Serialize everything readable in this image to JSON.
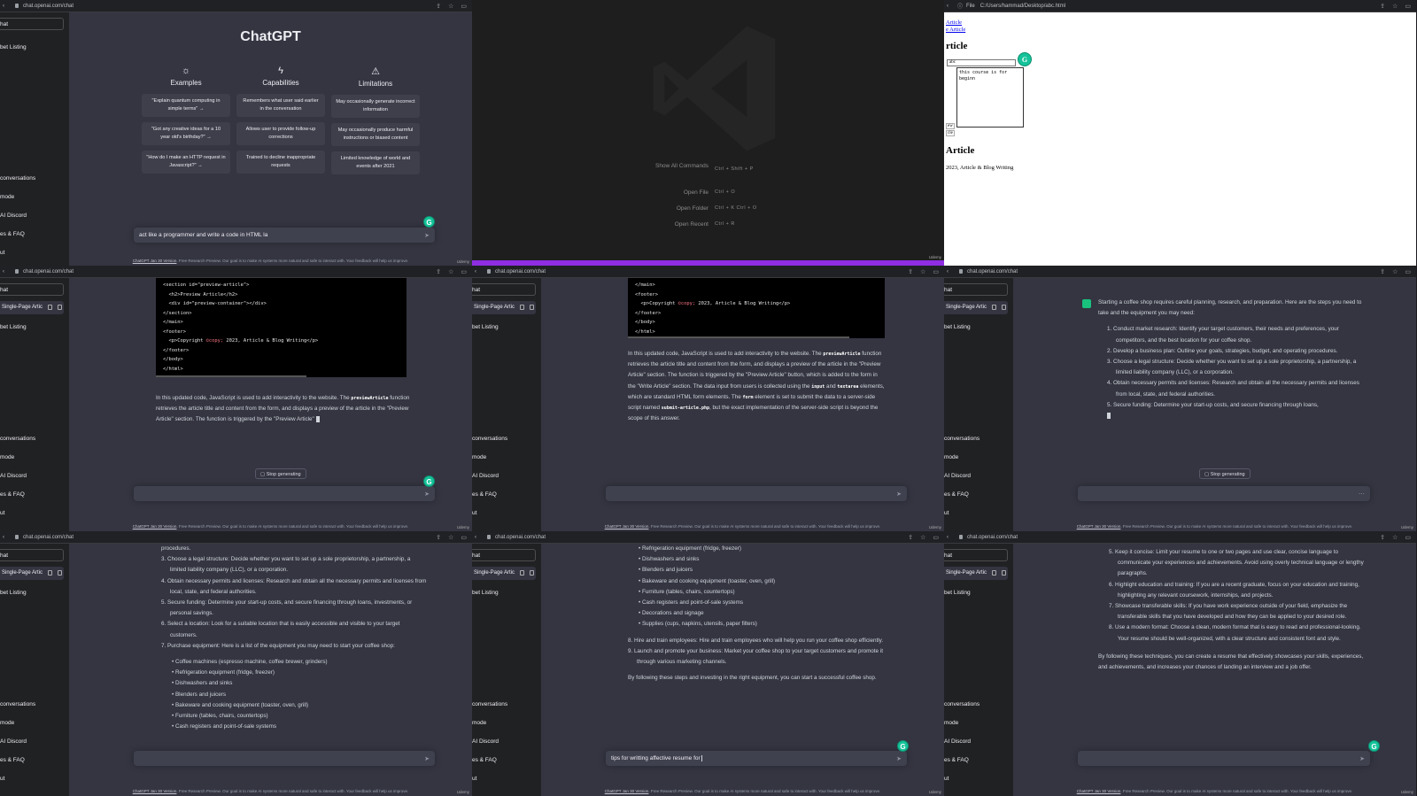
{
  "colors": {
    "accent": "#19c37d",
    "grammarly": "#15c39a",
    "bg": "#343541",
    "sidebar": "#202123",
    "purple": "#8e2de2"
  },
  "browser": {
    "url_chat": "chat.openai.com/chat",
    "file_label": "File",
    "url_file": "C:/Users/hammad/Desktop/abc.html"
  },
  "sidebar": {
    "chat_label": "hat",
    "listing_label": "bet Listing",
    "conv_title": "Single-Page Artic",
    "clear_label": "conversations",
    "mode_label": "mode",
    "discord_label": "AI Discord",
    "faq_label": "es & FAQ",
    "logout_label": "ut"
  },
  "footer": {
    "link": "ChatGPT Jan 30 Version",
    "text": ". Free Research Preview. Our goal is to make AI systems more natural and safe to interact with. Your feedback will help us improve.",
    "udemy": "Udemy"
  },
  "welcome": {
    "title": "ChatGPT",
    "columns": [
      {
        "heading": "Examples",
        "icon": "sun-icon",
        "cards": [
          "\"Explain quantum computing in simple terms\" →",
          "\"Got any creative ideas for a 10 year old's birthday?\" →",
          "\"How do I make an HTTP request in Javascript?\" →"
        ]
      },
      {
        "heading": "Capabilities",
        "icon": "lightning-icon",
        "cards": [
          "Remembers what user said earlier in the conversation",
          "Allows user to provide follow-up corrections",
          "Trained to decline inappropriate requests"
        ]
      },
      {
        "heading": "Limitations",
        "icon": "warning-icon",
        "cards": [
          "May occasionally generate incorrect information",
          "May occasionally produce harmful instructions or biased content",
          "Limited knowledge of world and events after 2021"
        ]
      }
    ],
    "input_value": "act like a programmer and write a code in HTML la"
  },
  "vscode": {
    "commands": [
      {
        "label": "Show All Commands",
        "keys": "Ctrl + Shift + P"
      },
      {
        "label": "Open File",
        "keys": "Ctrl + O"
      },
      {
        "label": "Open Folder",
        "keys": "Ctrl + K   Ctrl + O"
      },
      {
        "label": "Open Recent",
        "keys": "Ctrl + R"
      }
    ]
  },
  "preview": {
    "link1": "Article",
    "link2": "e Article",
    "heading1": "rticle",
    "field_value": "abc",
    "textarea_value": "this course is for beginn",
    "small1": "ew",
    "small2": "cle",
    "heading2": "Article",
    "copyright": "2023, Article & Blog Writing"
  },
  "code1": {
    "lines": [
      "<section id=\"preview-article\">",
      "  <h2>Preview Article</h2>",
      "  <div id=\"preview-container\"></div>",
      "</section>",
      "</main>",
      "<footer>",
      "  <p>Copyright ©copy; 2023, Article & Blog Writing</p>",
      "</footer>",
      "</body>",
      "</html>"
    ]
  },
  "answer1": {
    "p1": "In this updated code, JavaScript is used to add interactivity to the website. The",
    "b1": "previewArticle",
    "p2": " function retrieves the article title and content from the form, and displays a preview of the article in the \"Preview Article\" section. The function is triggered by the \"Preview Article\"",
    "stop": "Stop generating"
  },
  "code2": {
    "lines": [
      "</main>",
      "<footer>",
      "  <p>Copyright ©copy; 2023, Article & Blog Writing</p>",
      "</footer>",
      "</body>",
      "</html>"
    ]
  },
  "answer2": {
    "a": "In this updated code, JavaScript is used to add interactivity to the website. The ",
    "b1": "previewArticle",
    "c": " function retrieves the article title and content from the form, and displays a preview of the article in the \"Preview Article\" section. The function is triggered by the \"Preview Article\" button, which is added to the form in the \"Write Article\" section. The data input from users is collected using the ",
    "b2": "input",
    "d": " and ",
    "b3": "textarea",
    "e": " elements, which are standard HTML form elements. The ",
    "b4": "form",
    "f": " element is set to submit the data to a server-side script named ",
    "b5": "submit-article.php",
    "g": ", but the exact implementation of the server-side script is beyond the scope of this answer."
  },
  "coffee": {
    "intro": "Starting a coffee shop requires careful planning, research, and preparation. Here are the steps you need to take and the equipment you may need:",
    "steps": [
      "Conduct market research: Identify your target customers, their needs and preferences, your competitors, and the best location for your coffee shop.",
      "Develop a business plan: Outline your goals, strategies, budget, and operating procedures.",
      "Choose a legal structure: Decide whether you want to set up a sole proprietorship, a partnership, a limited liability company (LLC), or a corporation.",
      "Obtain necessary permits and licenses: Research and obtain all the necessary permits and licenses from local, state, and federal authorities.",
      "Secure funding: Determine your start-up costs, and secure financing through loans,"
    ],
    "stop": "Stop generating"
  },
  "coffee2": {
    "top": "procedures.",
    "steps": [
      {
        "n": "3.",
        "t": "Choose a legal structure: Decide whether you want to set up a sole proprietorship, a partnership, a limited liability company (LLC), or a corporation."
      },
      {
        "n": "4.",
        "t": "Obtain necessary permits and licenses: Research and obtain all the necessary permits and licenses from local, state, and federal authorities."
      },
      {
        "n": "5.",
        "t": "Secure funding: Determine your start-up costs, and secure financing through loans, investments, or personal savings."
      },
      {
        "n": "6.",
        "t": "Select a location: Look for a suitable location that is easily accessible and visible to your target customers."
      },
      {
        "n": "7.",
        "t": "Purchase equipment: Here is a list of the equipment you may need to start your coffee shop:"
      }
    ],
    "bullets": [
      "Coffee machines (espresso machine, coffee brewer, grinders)",
      "Refrigeration equipment (fridge, freezer)",
      "Dishwashers and sinks",
      "Blenders and juicers",
      "Bakeware and cooking equipment (toaster, oven, grill)",
      "Furniture (tables, chairs, countertops)",
      "Cash registers and point-of-sale systems"
    ]
  },
  "coffee3": {
    "top": "Refrigeration equipment (fridge, freezer)",
    "bullets": [
      "Dishwashers and sinks",
      "Blenders and juicers",
      "Bakeware and cooking equipment (toaster, oven, grill)",
      "Furniture (tables, chairs, countertops)",
      "Cash registers and point-of-sale systems",
      "Decorations and signage",
      "Supplies (cups, napkins, utensils, paper filters)"
    ],
    "steps": [
      {
        "n": "8.",
        "t": "Hire and train employees: Hire and train employees who will help you run your coffee shop efficiently."
      },
      {
        "n": "9.",
        "t": "Launch and promote your business: Market your coffee shop to your target customers and promote it through various marketing channels."
      }
    ],
    "closing": "By following these steps and investing in the right equipment, you can start a successful coffee shop.",
    "input_value": "tips for writting affective resume for "
  },
  "resume": {
    "steps": [
      {
        "n": "5.",
        "t": "Keep it concise: Limit your resume to one or two pages and use clear, concise language to communicate your experiences and achievements. Avoid using overly technical language or lengthy paragraphs."
      },
      {
        "n": "6.",
        "t": "Highlight education and training: If you are a recent graduate, focus on your education and training, highlighting any relevant coursework, internships, and projects."
      },
      {
        "n": "7.",
        "t": "Showcase transferable skills: If you have work experience outside of your field, emphasize the transferable skills that you have developed and how they can be applied to your desired role."
      },
      {
        "n": "8.",
        "t": "Use a modern format: Choose a clean, modern format that is easy to read and professional-looking. Your resume should be well-organized, with a clear structure and consistent font and style."
      }
    ],
    "closing": "By following these techniques, you can create a resume that effectively showcases your skills, experiences, and achievements, and increases your chances of landing an interview and a job offer."
  }
}
